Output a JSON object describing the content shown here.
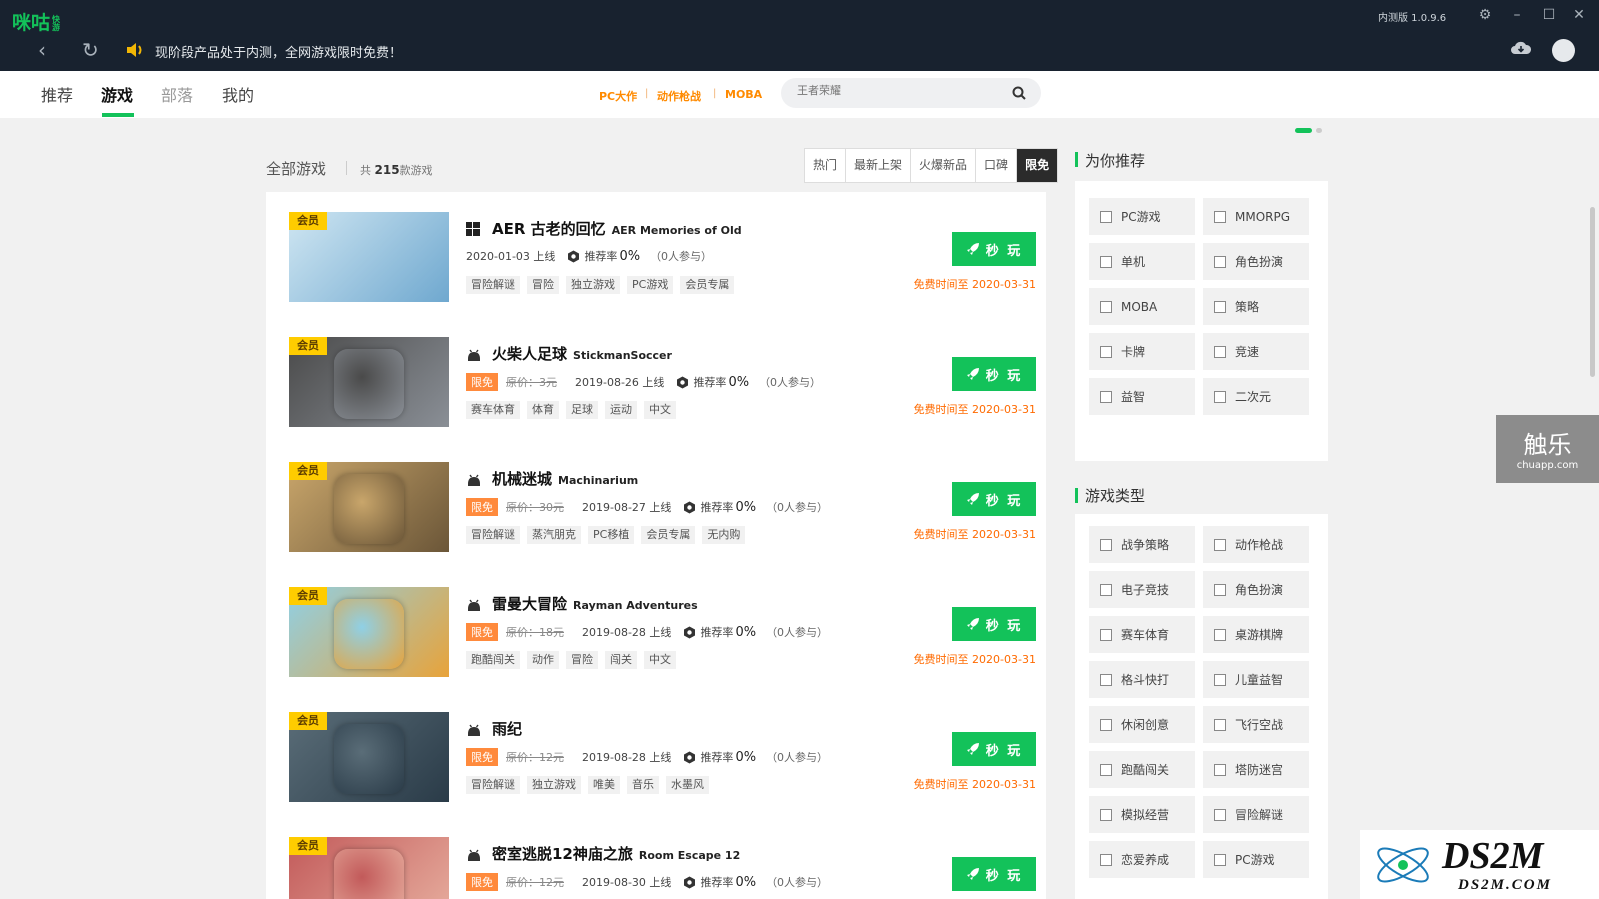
{
  "titlebar": {
    "logo": "咪咕",
    "logo_sub": "快游",
    "version": "内测版 1.0.9.6",
    "notice": "现阶段产品处于内测，全网游戏限时免费！"
  },
  "nav": {
    "tabs": [
      "推荐",
      "游戏",
      "部落",
      "我的"
    ],
    "active_tab": "游戏",
    "quick_links": [
      "PC大作",
      "动作枪战",
      "MOBA"
    ],
    "search_placeholder": "王者荣耀"
  },
  "list_header": {
    "title": "全部游戏",
    "count_prefix": "共",
    "count": "215",
    "count_suffix": "款游戏",
    "filters": [
      "热门",
      "最新上架",
      "火爆新品",
      "口碑",
      "限免"
    ],
    "active_filter": "限免"
  },
  "games": [
    {
      "title": "AER 古老的回忆",
      "en": "AER Memories of Old",
      "platform": "windows-icon",
      "free_tag": "",
      "orig_price": "",
      "date": "2020-01-03 上线",
      "rec_label": "推荐率",
      "rec": "0%",
      "participants": "（0人参与）",
      "tags": [
        "冒险解谜",
        "冒险",
        "独立游戏",
        "PC游戏",
        "会员专属"
      ],
      "badge": "会员",
      "play": "秒 玩",
      "free_until": "免费时间至 2020-03-31",
      "colors": [
        "#cfe6f2",
        "#6fa8cf"
      ]
    },
    {
      "title": "火柴人足球",
      "en": "StickmanSoccer",
      "platform": "android-icon",
      "free_tag": "限免",
      "orig_price": "原价：3元",
      "date": "2019-08-26 上线",
      "rec_label": "推荐率",
      "rec": "0%",
      "participants": "（0人参与）",
      "tags": [
        "赛车体育",
        "体育",
        "足球",
        "运动",
        "中文"
      ],
      "badge": "会员",
      "play": "秒 玩",
      "free_until": "免费时间至 2020-03-31",
      "colors": [
        "#4a4a4a",
        "#8a8f96"
      ]
    },
    {
      "title": "机械迷城",
      "en": "Machinarium",
      "platform": "android-icon",
      "free_tag": "限免",
      "orig_price": "原价：30元",
      "date": "2019-08-27 上线",
      "rec_label": "推荐率",
      "rec": "0%",
      "participants": "（0人参与）",
      "tags": [
        "冒险解谜",
        "蒸汽朋克",
        "PC移植",
        "会员专属",
        "无内购"
      ],
      "badge": "会员",
      "play": "秒 玩",
      "free_until": "免费时间至 2020-03-31",
      "colors": [
        "#c9a66b",
        "#6b5638"
      ]
    },
    {
      "title": "雷曼大冒险",
      "en": "Rayman Adventures",
      "platform": "android-icon",
      "free_tag": "限免",
      "orig_price": "原价：18元",
      "date": "2019-08-28 上线",
      "rec_label": "推荐率",
      "rec": "0%",
      "participants": "（0人参与）",
      "tags": [
        "跑酷闯关",
        "动作",
        "冒险",
        "闯关",
        "中文"
      ],
      "badge": "会员",
      "play": "秒 玩",
      "free_until": "免费时间至 2020-03-31",
      "colors": [
        "#8fd0e6",
        "#e8a33a"
      ]
    },
    {
      "title": "雨纪",
      "en": "",
      "platform": "android-icon",
      "free_tag": "限免",
      "orig_price": "原价：12元",
      "date": "2019-08-28 上线",
      "rec_label": "推荐率",
      "rec": "0%",
      "participants": "（0人参与）",
      "tags": [
        "冒险解谜",
        "独立游戏",
        "唯美",
        "音乐",
        "水墨风"
      ],
      "badge": "会员",
      "play": "秒 玩",
      "free_until": "免费时间至 2020-03-31",
      "colors": [
        "#5a6d78",
        "#2a3b48"
      ]
    },
    {
      "title": "密室逃脱12神庙之旅",
      "en": "Room Escape 12",
      "platform": "android-icon",
      "free_tag": "限免",
      "orig_price": "原价：12元",
      "date": "2019-08-30 上线",
      "rec_label": "推荐率",
      "rec": "0%",
      "participants": "（0人参与）",
      "tags": [],
      "badge": "会员",
      "play": "秒 玩",
      "free_until": "",
      "colors": [
        "#c25a5a",
        "#e8b0a0"
      ]
    }
  ],
  "recommend": {
    "title": "为你推荐",
    "items": [
      "PC游戏",
      "MMORPG",
      "单机",
      "角色扮演",
      "MOBA",
      "策略",
      "卡牌",
      "竞速",
      "益智",
      "二次元"
    ]
  },
  "genres": {
    "title": "游戏类型",
    "items": [
      "战争策略",
      "动作枪战",
      "电子竞技",
      "角色扮演",
      "赛车体育",
      "桌游棋牌",
      "格斗快打",
      "儿童益智",
      "休闲创意",
      "飞行空战",
      "跑酷闯关",
      "塔防迷宫",
      "模拟经营",
      "冒险解谜",
      "恋爱养成",
      "PC游戏"
    ]
  },
  "overlays": {
    "chuapp_big": "触乐",
    "chuapp_small": "chuapp.com",
    "watermark": "DS2M",
    "watermark_sub": "DS2M.COM"
  },
  "colors": {
    "accent": "#13c25a",
    "orange": "#ff8a00",
    "titlebar": "#18222f"
  }
}
